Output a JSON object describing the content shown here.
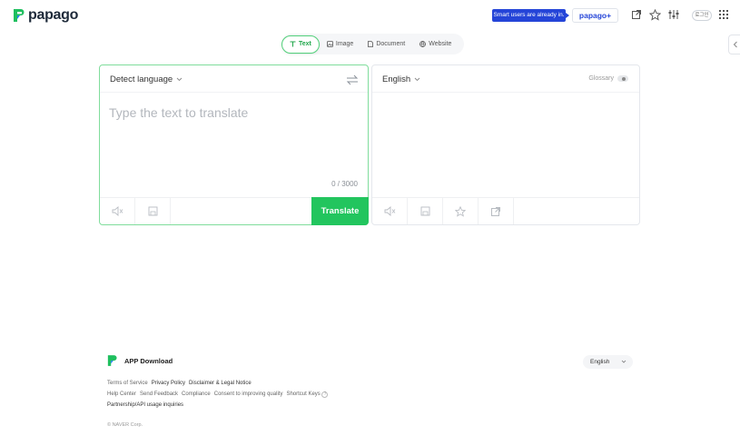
{
  "header": {
    "logo_text": "papago",
    "promo_tooltip": "Smart users are already in.",
    "plus_button": "papago+",
    "login_button": "로그인"
  },
  "tabs": [
    {
      "label": "Text",
      "icon": "text-icon",
      "active": true
    },
    {
      "label": "Image",
      "icon": "image-icon",
      "active": false
    },
    {
      "label": "Document",
      "icon": "document-icon",
      "active": false
    },
    {
      "label": "Website",
      "icon": "globe-icon",
      "active": false
    }
  ],
  "source": {
    "language": "Detect language",
    "placeholder": "Type the text to translate",
    "counter": "0 / 3000",
    "translate_button": "Translate"
  },
  "target": {
    "language": "English",
    "glossary_label": "Glossary"
  },
  "footer": {
    "app_download": "APP Download",
    "language_select": "English",
    "links_row1": [
      "Terms of Service",
      "Privacy Policy",
      "Disclaimer & Legal Notice"
    ],
    "links_row2": [
      "Help Center",
      "Send Feedback",
      "Compliance",
      "Consent to improving quality",
      "Shortcut Keys"
    ],
    "links_row3": [
      "Partnership/API usage inquiries"
    ],
    "copyright": "© NAVER Corp."
  },
  "colors": {
    "accent_green": "#22c55e",
    "brand_blue": "#2545d8"
  }
}
